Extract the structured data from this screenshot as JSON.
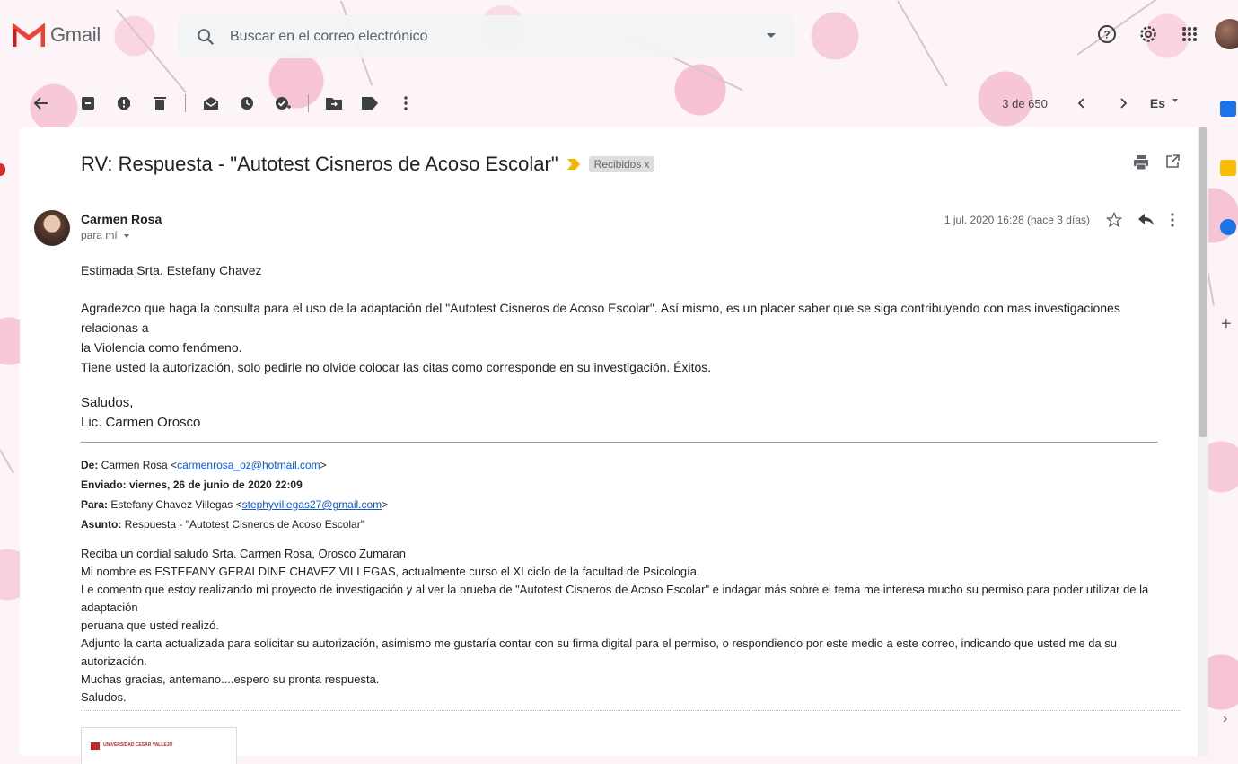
{
  "app": {
    "name": "Gmail"
  },
  "search": {
    "placeholder": "Buscar en el correo electrónico"
  },
  "toolbar": {
    "pager": "3 de 650",
    "language": "Es"
  },
  "email": {
    "subject": "RV: Respuesta - \"Autotest Cisneros de Acoso Escolar\"",
    "label": "Recibidos",
    "label_remove": "x",
    "sender": "Carmen Rosa",
    "recipient": "para mí",
    "date": "1 jul. 2020 16:28 (hace 3 días)",
    "body": {
      "greeting": "Estimada Srta. Estefany Chavez",
      "para1_line1": "Agradezco que haga la consulta para el uso de la adaptación del \"Autotest Cisneros de Acoso Escolar\". Así mismo, es un placer saber que se siga contribuyendo con mas investigaciones relacionas a",
      "para1_line2": "la Violencia como fenómeno.",
      "para2": "Tiene usted la autorización, solo pedirle no olvide colocar las citas como corresponde en su investigación. Éxitos.",
      "closing": "Saludos,",
      "signature": "Lic. Carmen Orosco"
    },
    "forwarded": {
      "from_label": "De:",
      "from_name": "Carmen Rosa <",
      "from_email": "carmenrosa_oz@hotmail.com",
      "from_end": ">",
      "sent_label": "Enviado:",
      "sent_value": "viernes, 26 de junio de 2020 22:09",
      "to_label": "Para:",
      "to_name": "Estefany Chavez Villegas <",
      "to_email": "stephyvillegas27@gmail.com",
      "to_end": ">",
      "subject_label": "Asunto:",
      "subject_value": "Respuesta - \"Autotest Cisneros de Acoso Escolar\""
    },
    "original": {
      "line1": "Reciba un cordial saludo Srta. Carmen Rosa, Orosco Zumaran",
      "line2": "Mi nombre es ESTEFANY GERALDINE CHAVEZ VILLEGAS, actualmente curso el XI ciclo de la facultad de Psicología.",
      "line3": "Le comento que estoy realizando mi proyecto de investigación y al ver la prueba de  \"Autotest Cisneros de Acoso Escolar\" e indagar más sobre el tema me interesa mucho su permiso para poder utilizar de la adaptación",
      "line4": "peruana que usted realizó.",
      "line5": "Adjunto la carta actualizada para solicitar su autorización, asimismo me gustaría contar con su firma digital para el permiso, o respondiendo por este medio a este correo, indicando que usted me da su autorización.",
      "line6": "Muchas gracias, antemano....espero su pronta respuesta.",
      "line7": "Saludos."
    },
    "attachment_text": "UNIVERSIDAD CÉSAR VALLEJO"
  },
  "colors": {
    "gmail_red": "#ea4335",
    "link": "#1155cc",
    "label_bg": "#dddddd"
  },
  "icons": [
    "back-icon",
    "archive-icon",
    "spam-icon",
    "delete-icon",
    "mark-unread-icon",
    "snooze-icon",
    "add-task-icon",
    "move-to-icon",
    "label-icon",
    "more-icon",
    "print-icon",
    "new-window-icon",
    "star-icon",
    "reply-icon",
    "help-icon",
    "settings-icon",
    "apps-icon"
  ]
}
